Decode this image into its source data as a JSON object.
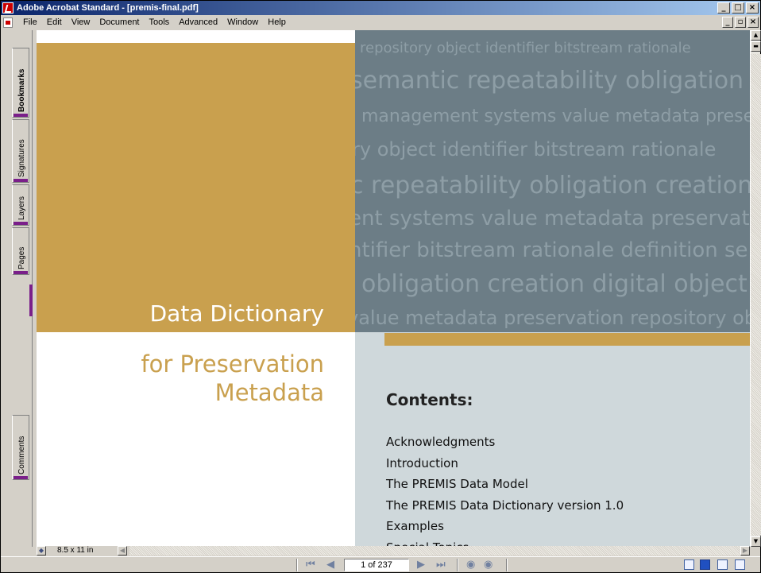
{
  "window": {
    "title": "Adobe Acrobat Standard - [premis-final.pdf]",
    "caption_buttons": [
      "_",
      "□",
      "×"
    ]
  },
  "menubar": {
    "items": [
      "File",
      "Edit",
      "View",
      "Document",
      "Tools",
      "Advanced",
      "Window",
      "Help"
    ],
    "mdi_buttons": [
      "_",
      "▫",
      "×"
    ]
  },
  "nav_panel": {
    "tabs": [
      {
        "label": "Bookmarks",
        "active": true
      },
      {
        "label": "Signatures",
        "active": false
      },
      {
        "label": "Layers",
        "active": false
      },
      {
        "label": "Pages",
        "active": false
      },
      {
        "label": "Comments",
        "active": false
      }
    ]
  },
  "page": {
    "title_line1": "Data Dictionary",
    "title_line2": "for Preservation",
    "title_line3": "Metadata",
    "word_cloud": [
      "repository object identifier bitstream rationale",
      "semantic repeatability obligation creation",
      "management systems value metadata preservation",
      "ry object identifier bitstream rationale",
      "c repeatability obligation creation",
      "ent systems value metadata preservation",
      "ntifier bitstream rationale definition se",
      "obligation creation digital object m",
      "value metadata preservation repository obje"
    ],
    "contents_heading": "Contents:",
    "contents_items": [
      "Acknowledgments",
      "Introduction",
      "The PREMIS Data Model",
      "The PREMIS Data Dictionary version 1.0",
      "Examples",
      "Special Topics"
    ]
  },
  "hscroll": {
    "page_size": "8.5 x 11 in"
  },
  "statusbar": {
    "page_indicator": "1 of 237",
    "first_icon": "first-page-icon",
    "prev_icon": "previous-page-icon",
    "next_icon": "next-page-icon",
    "last_icon": "last-page-icon",
    "back_icon": "previous-view-icon",
    "forward_icon": "next-view-icon"
  },
  "colors": {
    "ocre": "#c9a04e",
    "slate": "#6c7d86",
    "light_blue": "#cfd8db",
    "title_bar": "#0a246a"
  }
}
